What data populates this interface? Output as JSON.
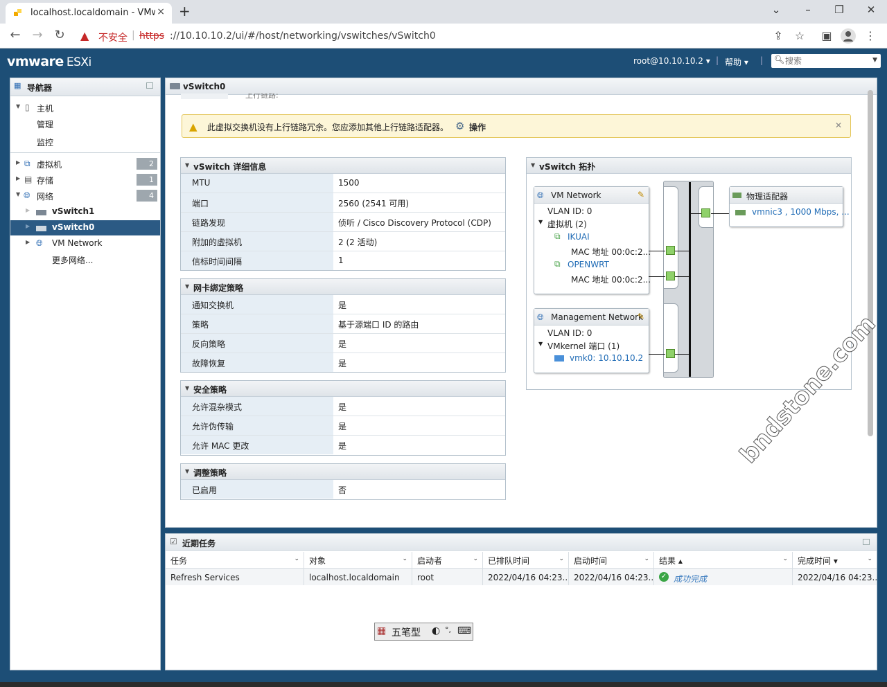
{
  "browser": {
    "tab_title": "localhost.localdomain - VMware ESXi",
    "tab_close": "×",
    "new_tab": "+",
    "security_label": "不安全",
    "url_scheme": "https",
    "url_rest": "://10.10.10.2/ui/#/host/networking/vswitches/vSwitch0",
    "minimize": "⌄",
    "min2": "–",
    "restore": "❐",
    "close": "✕"
  },
  "header": {
    "logo_vm": "vmware",
    "logo_esxi": "ESXi",
    "user": "root@10.10.10.2 ▾",
    "help": "帮助 ▾",
    "search_placeholder": "搜索"
  },
  "navigator": {
    "title": "导航器",
    "items": [
      {
        "label": "主机"
      },
      {
        "label": "管理"
      },
      {
        "label": "监控"
      },
      {
        "label": "虚拟机",
        "count": "2"
      },
      {
        "label": "存储",
        "count": "1"
      },
      {
        "label": "网络",
        "count": "4"
      },
      {
        "label": "vSwitch1"
      },
      {
        "label": "vSwitch0"
      },
      {
        "label": "VM Network"
      },
      {
        "label": "更多网络..."
      }
    ]
  },
  "main": {
    "title": "vSwitch0",
    "cut_text": "上行链路:",
    "banner": {
      "message": "此虚拟交换机没有上行链路冗余。您应添加其他上行链路适配器。",
      "action": "操作"
    },
    "details": {
      "title": "vSwitch 详细信息",
      "rows": [
        {
          "k": "MTU",
          "v": "1500"
        },
        {
          "k": "端口",
          "v": "2560 (2541 可用)"
        },
        {
          "k": "链路发现",
          "v": "侦听 / Cisco Discovery Protocol (CDP)"
        },
        {
          "k": "附加的虚拟机",
          "v": "2 (2 活动)"
        },
        {
          "k": "信标时间间隔",
          "v": "1"
        }
      ]
    },
    "teaming": {
      "title": "网卡绑定策略",
      "rows": [
        {
          "k": "通知交换机",
          "v": "是"
        },
        {
          "k": "策略",
          "v": "基于源端口 ID 的路由"
        },
        {
          "k": "反向策略",
          "v": "是"
        },
        {
          "k": "故障恢复",
          "v": "是"
        }
      ]
    },
    "security": {
      "title": "安全策略",
      "rows": [
        {
          "k": "允许混杂模式",
          "v": "是"
        },
        {
          "k": "允许伪传输",
          "v": "是"
        },
        {
          "k": "允许 MAC 更改",
          "v": "是"
        }
      ]
    },
    "shaping": {
      "title": "调整策略",
      "rows": [
        {
          "k": "已启用",
          "v": "否"
        }
      ]
    },
    "topology": {
      "title": "vSwitch 拓扑",
      "vm_network": {
        "name": "VM Network",
        "vlan": "VLAN ID: 0",
        "vms": "虚拟机 (2)",
        "vm1": "IKUAI",
        "mac1": "MAC 地址 00:0c:2...",
        "vm2": "OPENWRT",
        "mac2": "MAC 地址 00:0c:2..."
      },
      "mgmt_network": {
        "name": "Management Network",
        "vlan": "VLAN ID: 0",
        "ports": "VMkernel 端口 (1)",
        "vmk": "vmk0: 10.10.10.2"
      },
      "physical": {
        "title": "物理适配器",
        "nic": "vmnic3 , 1000 Mbps, ..."
      }
    }
  },
  "tasks": {
    "title": "近期任务",
    "columns": [
      "任务",
      "对象",
      "启动者",
      "已排队时间",
      "启动时间",
      "结果 ▴",
      "完成时间 ▾"
    ],
    "rows": [
      {
        "task": "Refresh Services",
        "object": "localhost.localdomain",
        "initiator": "root",
        "queued": "2022/04/16 04:23...",
        "started": "2022/04/16 04:23...",
        "result": "成功完成",
        "completed": "2022/04/16 04:23..."
      }
    ]
  },
  "ime": {
    "label": "五笔型"
  },
  "watermark": "bndstone.com",
  "colors": {
    "header_bg": "#1d4e76",
    "selected": "#2b5a84",
    "port_green": "#8fd16a",
    "warning_bg": "#fdf6d8"
  }
}
